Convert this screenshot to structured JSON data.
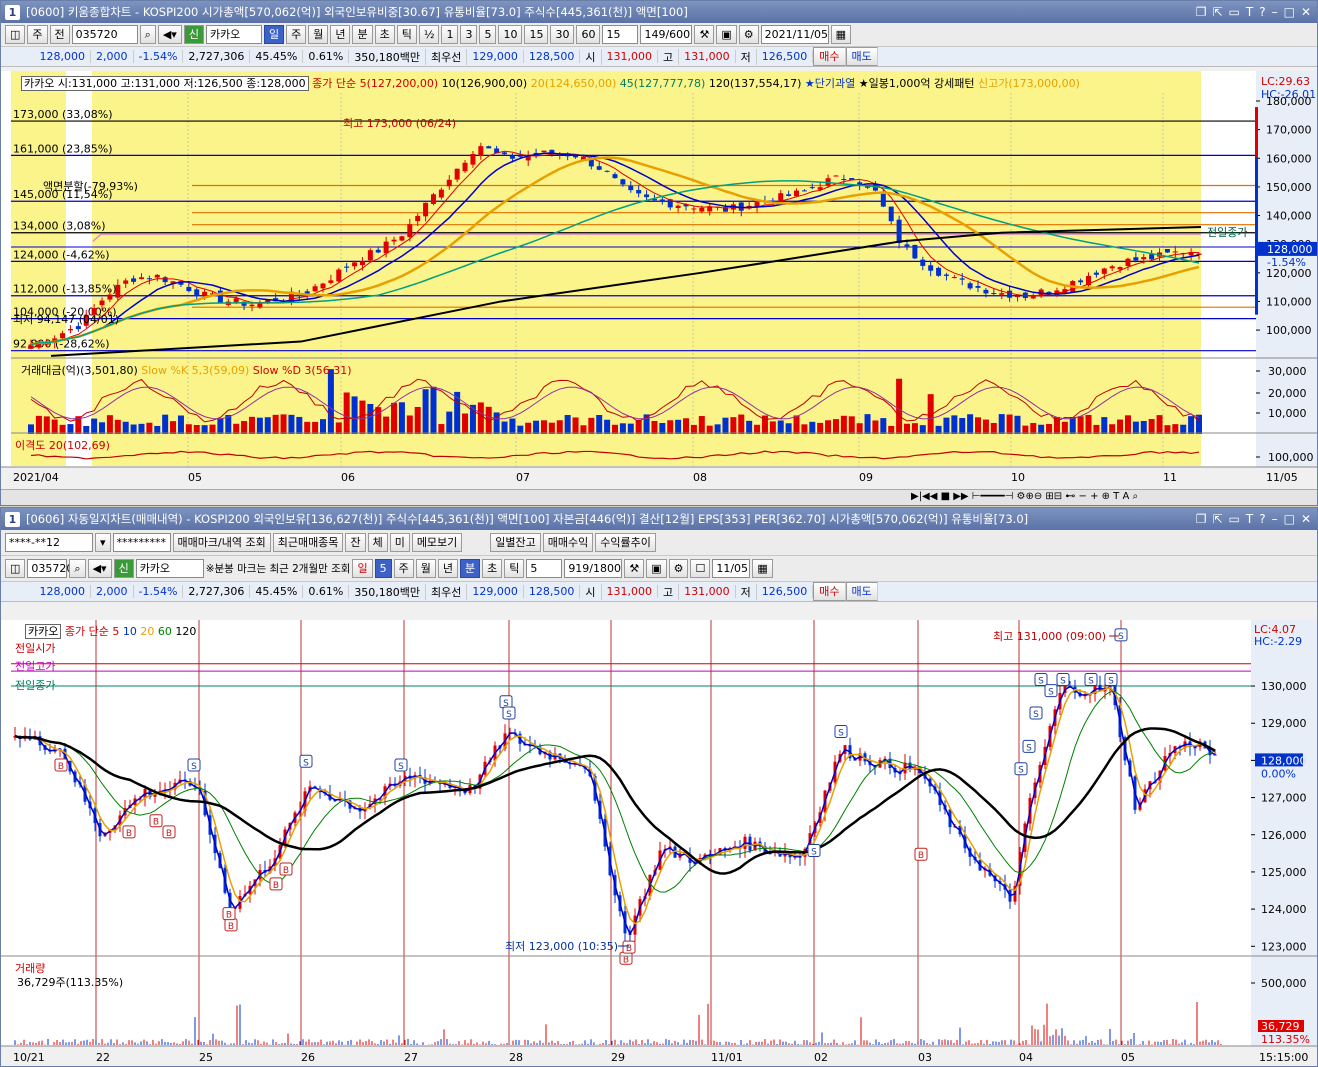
{
  "top": {
    "title": "[0600] 키움종합차트 - KOSPI200 시가총액[570,062(억)] 외국인보유비중[30.67] 유통비율[73.0] 주식수[445,361(천)] 액면[100]",
    "win_num": "1",
    "toolbar": {
      "period": "주",
      "prev": "전",
      "code": "035720",
      "stock": "카카오",
      "stock_tag": "신",
      "periods": [
        "일",
        "주",
        "월",
        "년",
        "분",
        "초",
        "틱"
      ],
      "periods_sel": "일",
      "ticks": [
        "1",
        "3",
        "5",
        "10",
        "15",
        "30",
        "60"
      ],
      "tick_val": "15",
      "count": "149/600",
      "date": "2021/11/05"
    },
    "info": {
      "price": "128,000",
      "chg": "2,000",
      "pct": "-1.54%",
      "vol": "2,727,306",
      "r1": "45.45%",
      "r2": "0.61%",
      "amt": "350,180백만",
      "best_label": "최우선",
      "best1": "129,000",
      "best2": "128,500",
      "open_l": "시",
      "open": "131,000",
      "high_l": "고",
      "high": "131,000",
      "low_l": "저",
      "low": "126,500",
      "buy": "매수",
      "sell": "매도"
    },
    "legend": {
      "box": "카카오 시:131,000 고:131,000 저:126,500 종:128,000",
      "ma0": "종가 단순 5(127,200,00)",
      "ma1": "10(126,900,00)",
      "ma2": "20(124,650,00)",
      "ma3": "45(127,777,78)",
      "ma4": "120(137,554,17)",
      "e1": "★단기과열",
      "e2": "★일봉1,000억 강세패턴",
      "e3": "신고가(173,000,00)"
    },
    "lc": "LC:29.63",
    "hc": "HC:-26.01",
    "levels": [
      {
        "t": "173,000 (33,08%)",
        "v": 173000,
        "c": "#000"
      },
      {
        "t": "161,000 (23,85%)",
        "v": 161000,
        "c": "#0000cc"
      },
      {
        "t": "145,000 (11,54%)",
        "v": 145000,
        "c": "#0000cc"
      },
      {
        "t": "134,000 (3,08%)",
        "v": 134000,
        "c": "#000"
      },
      {
        "t": "124,000 (-4,62%)",
        "v": 124000,
        "c": "#0000cc"
      },
      {
        "t": "112,000 (-13,85%)",
        "v": 112000,
        "c": "#0000cc"
      },
      {
        "t": "104,000 (-20,00%)",
        "v": 104000,
        "c": "#0000cc"
      },
      {
        "t": "92,800 (-28,62%)",
        "v": 92800,
        "c": "#0000cc"
      }
    ],
    "ann": {
      "hi": "최고 173,000 (06/24)",
      "split": "액면분할(-79,93%)",
      "lo": "최저 94,147 (04/01)",
      "prev_close": "전일종가"
    },
    "yticks": [
      "180,000",
      "170,000",
      "160,000",
      "150,000",
      "140,000",
      "130,000",
      "120,000",
      "110,000",
      "100,000"
    ],
    "price_tag": "128,000",
    "price_pct": "-1.54%",
    "sub1_legend": {
      "a": "거래대금(억)(3,501,80)",
      "b": "Slow %K 5,3(59,09)",
      "c": "Slow %D 3(56,31)"
    },
    "sub1_ticks": [
      "30,000",
      "20,000",
      "10,000"
    ],
    "sub2_legend": "이격도 20(102,69)",
    "sub2_tick": "100,000",
    "xlabels": [
      "2021/04",
      "05",
      "06",
      "07",
      "08",
      "09",
      "10",
      "11",
      "11/05"
    ]
  },
  "bot": {
    "title": "[0606] 자동일지차트(매매내역) - KOSPI200 외국인보유[136,627(천)] 주식수[445,361(천)] 액면[100] 자본금[446(억)] 결산[12월] EPS[353] PER[362.70] 시가총액[570,062(억)] 유통비율[73.0]",
    "win_num": "1",
    "tb1": {
      "acct": "****-**12",
      "pw": "*********",
      "b1": "매매마크/내역 조회",
      "b2": "최근매매종목",
      "b3": "잔",
      "b4": "체",
      "b5": "미",
      "b6": "메모보기",
      "b7": "일별잔고",
      "b8": "매매수익",
      "b9": "수익률추이"
    },
    "tb2": {
      "code": "035720",
      "stock": "카카오",
      "stock_tag": "신",
      "note": "※분봉 마크는 최근 2개월만 조회",
      "d_lbl": "일",
      "d_val": "5",
      "periods": [
        "주",
        "월",
        "년",
        "분",
        "초",
        "틱"
      ],
      "min_val": "5",
      "count": "919/1800",
      "date": "11/05"
    },
    "info": {
      "price": "128,000",
      "chg": "2,000",
      "pct": "-1.54%",
      "vol": "2,727,306",
      "r1": "45.45%",
      "r2": "0.61%",
      "amt": "350,180백만",
      "best_label": "최우선",
      "best1": "129,000",
      "best2": "128,500",
      "open_l": "시",
      "open": "131,000",
      "high_l": "고",
      "high": "131,000",
      "low_l": "저",
      "low": "126,500",
      "buy": "매수",
      "sell": "매도"
    },
    "legend": {
      "box": "카카오",
      "ma": "종가 단순",
      "m5": "5",
      "m10": "10",
      "m20": "20",
      "m60": "60",
      "m120": "120"
    },
    "side": [
      "전일시가",
      "전일고가",
      "전일종가"
    ],
    "lc": "LC:4.07",
    "hc": "HC:-2.29",
    "hi": "최고 131,000 (09:00)",
    "lo": "최저 123,000 (10:35)",
    "yticks": [
      "130,000",
      "129,000",
      "128,000",
      "127,000",
      "126,000",
      "125,000",
      "124,000",
      "123,000"
    ],
    "price_tag": "128,000",
    "price_pct": "0.00%",
    "vol_label": "거래량",
    "vol_val": "36,729주(113.35%)",
    "vol_tick": "500,000",
    "vol_tag": "36,729",
    "vol_pct": "113.35%",
    "xlabels": [
      "10/21",
      "22",
      "25",
      "26",
      "27",
      "28",
      "29",
      "11/01",
      "02",
      "03",
      "04",
      "05",
      "15:15:00"
    ]
  }
}
